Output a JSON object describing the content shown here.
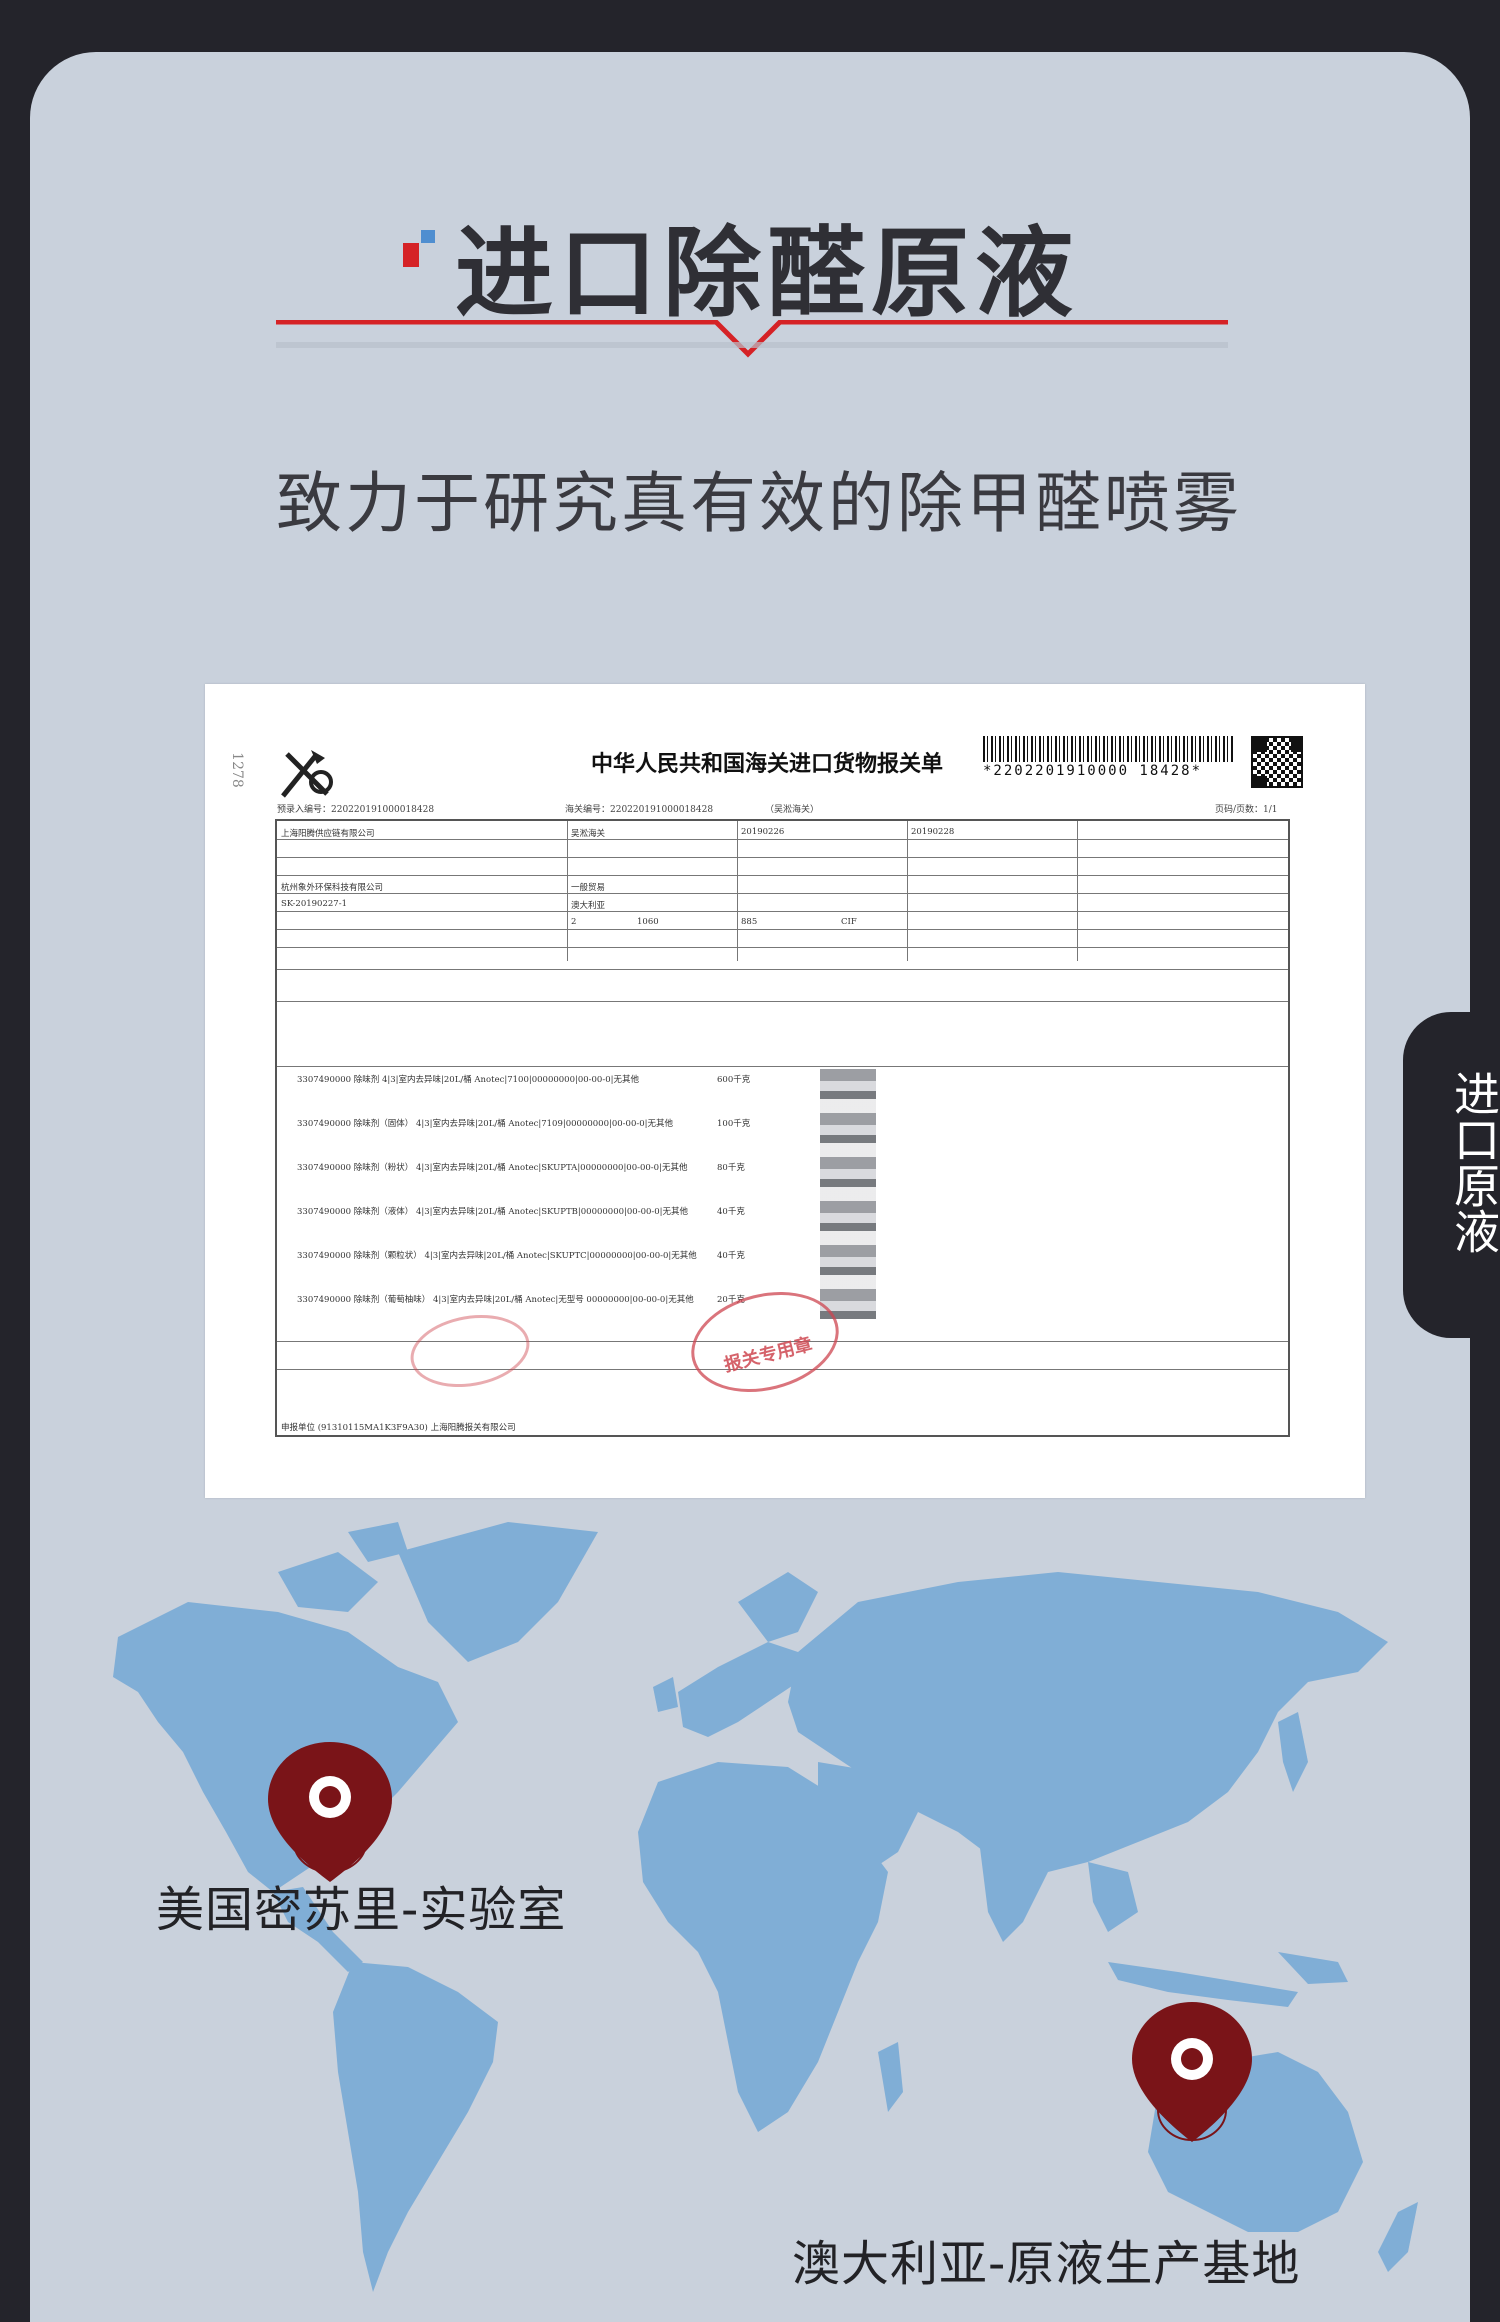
{
  "title": "进口除醛原液",
  "subtitle": "致力于研究真有效的除甲醛喷雾",
  "side_tab": "进口原液",
  "document": {
    "title": "中华人民共和国海关进口货物报关单",
    "barcode_number": "*2202201910000 18428*",
    "pre_entry_no": "预录入编号：220220191000018428",
    "customs_no": "海关编号：220220191000018428",
    "customs_office": "（吴淞海关）",
    "page": "页码/页数：1/1",
    "consignee": "上海阳腾供应链有限公司",
    "port": "吴淞海关",
    "import_date": "20190226",
    "declare_date": "20190228",
    "consumer": "杭州象外环保科技有限公司",
    "trade_mode": "一般贸易",
    "contract_no": "SK-20190227-1",
    "origin_country": "澳大利亚",
    "packages": "2",
    "gross_weight": "1060",
    "net_weight": "885",
    "transaction": "CIF",
    "goods_rows": [
      "3307490000 除味剂 4|3|室内去异味|20L/桶 Anotec|7100|00000000|00-00-0|无其他",
      "3307490000 除味剂（固体） 4|3|室内去异味|20L/桶 Anotec|7109|00000000|00-00-0|无其他",
      "3307490000 除味剂（粉状） 4|3|室内去异味|20L/桶 Anotec|SKUPTA|00000000|00-00-0|无其他",
      "3307490000 除味剂（液体） 4|3|室内去异味|20L/桶 Anotec|SKUPTB|00000000|00-00-0|无其他",
      "3307490000 除味剂（颗粒状） 4|3|室内去异味|20L/桶 Anotec|SKUPTC|00000000|00-00-0|无其他",
      "3307490000 除味剂（葡萄柚味） 4|3|室内去异味|20L/桶 Anotec|无型号 00000000|00-00-0|无其他"
    ],
    "quantities": [
      "600千克",
      "100千克",
      "80千克",
      "40千克",
      "40千克",
      "20千克"
    ],
    "stamp_text": "报关专用章",
    "declarant_unit": "申报单位 (91310115MA1K3F9A30) 上海阳腾报关有限公司"
  },
  "locations": {
    "usa_label": "美国密苏里-实验室",
    "australia_label": "澳大利亚-原液生产基地"
  },
  "colors": {
    "page_bg": "#24242b",
    "panel_bg": "#c9d1dc",
    "accent_red": "#d52226",
    "accent_blue": "#4f8ed0",
    "pin": "#7a1418",
    "map": "#80aed6"
  }
}
